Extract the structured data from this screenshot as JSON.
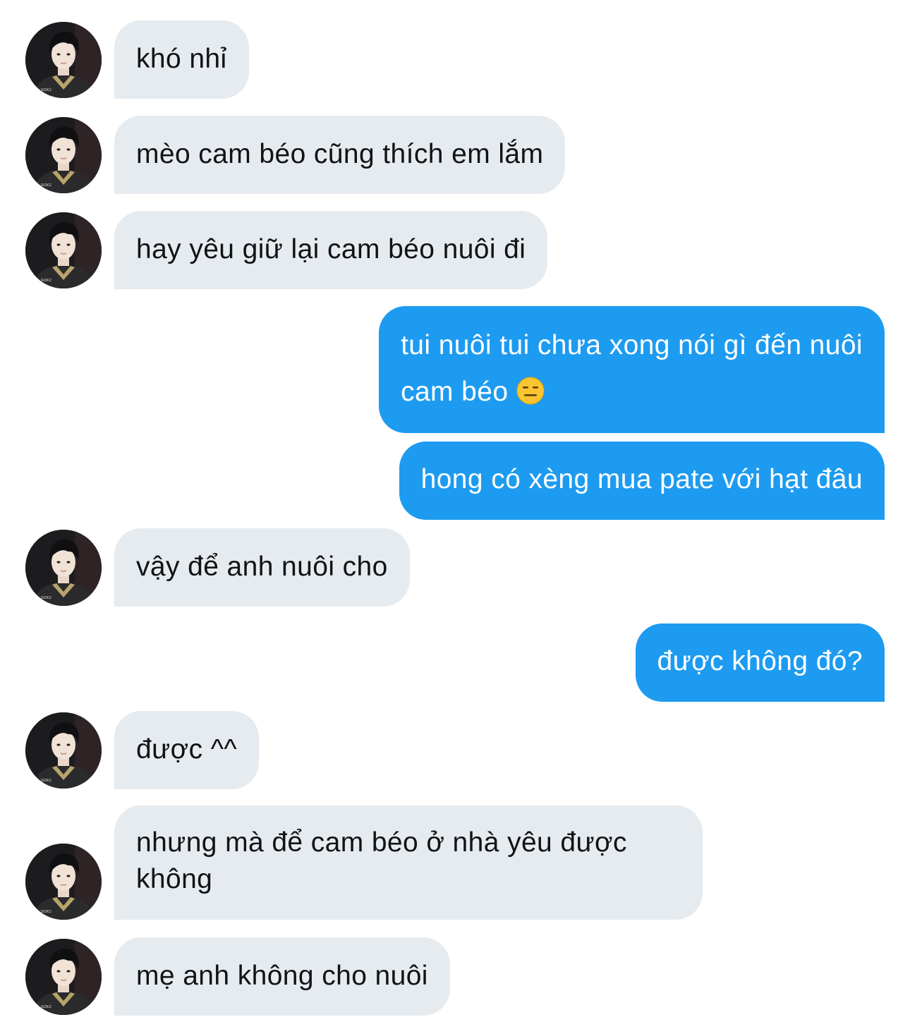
{
  "conversation": {
    "messages": [
      {
        "sender": "them",
        "text": "khó nhỉ"
      },
      {
        "sender": "them",
        "text": "mèo cam béo cũng thích em lắm"
      },
      {
        "sender": "them",
        "text": "hay yêu giữ lại cam béo nuôi đi"
      },
      {
        "sender": "me",
        "text_line1": "tui nuôi tui chưa xong nói gì đến nuôi",
        "text_line2": "cam béo",
        "emoji": "expressionless-face-emoji"
      },
      {
        "sender": "me",
        "text": "hong có xèng mua pate với hạt đâu"
      },
      {
        "sender": "them",
        "text": "vậy để anh nuôi cho"
      },
      {
        "sender": "me",
        "text": "được không đó?"
      },
      {
        "sender": "them",
        "text": "được ^^"
      },
      {
        "sender": "them",
        "text": "nhưng mà để cam béo ở nhà yêu được không"
      },
      {
        "sender": "them",
        "text": "mẹ anh không cho nuôi"
      }
    ]
  },
  "colors": {
    "incoming_bubble": "#e6ebef",
    "outgoing_bubble": "#1d9bf0",
    "incoming_text": "#111417",
    "outgoing_text": "#ffffff"
  },
  "icons": {
    "avatar": "avatar-photo",
    "emoji": "expressionless-face-emoji"
  }
}
